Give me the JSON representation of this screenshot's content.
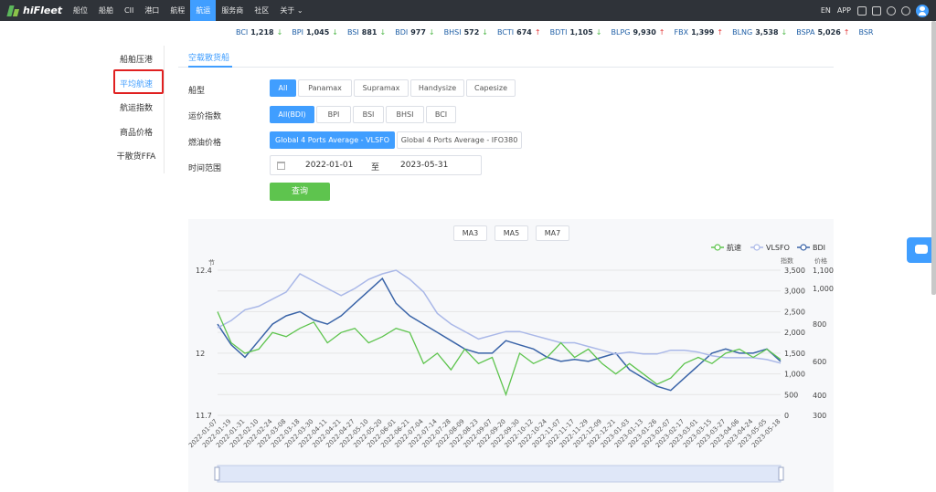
{
  "app": {
    "logo_text": "hiFleet",
    "accent": "#409eff"
  },
  "nav": {
    "items": [
      "船位",
      "船舶",
      "CII",
      "港口",
      "航程",
      "航运",
      "服务商",
      "社区",
      "关于"
    ],
    "active_index": 5
  },
  "top_right": {
    "lang": "EN",
    "app": "APP"
  },
  "ticker": [
    {
      "name": "BCI",
      "value": "1,218",
      "dir": "down"
    },
    {
      "name": "BPI",
      "value": "1,045",
      "dir": "down"
    },
    {
      "name": "BSI",
      "value": "881",
      "dir": "down"
    },
    {
      "name": "BDI",
      "value": "977",
      "dir": "down"
    },
    {
      "name": "BHSI",
      "value": "572",
      "dir": "down"
    },
    {
      "name": "BCTI",
      "value": "674",
      "dir": "up"
    },
    {
      "name": "BDTI",
      "value": "1,105",
      "dir": "down"
    },
    {
      "name": "BLPG",
      "value": "9,930",
      "dir": "up"
    },
    {
      "name": "FBX",
      "value": "1,399",
      "dir": "up"
    },
    {
      "name": "BLNG",
      "value": "3,538",
      "dir": "down"
    },
    {
      "name": "BSPA",
      "value": "5,026",
      "dir": "up"
    },
    {
      "name": "BSR",
      "value": "",
      "dir": ""
    }
  ],
  "sidebar": {
    "items": [
      "船舶压港",
      "平均航速",
      "航运指数",
      "商品价格",
      "干散货FFA"
    ],
    "active_index": 1
  },
  "tab": {
    "label": "空载散货船"
  },
  "filters": {
    "ship_type": {
      "label": "船型",
      "options": [
        "All",
        "Panamax",
        "Supramax",
        "Handysize",
        "Capesize"
      ],
      "selected": 0
    },
    "freight_index": {
      "label": "运价指数",
      "options": [
        "All(BDI)",
        "BPI",
        "BSI",
        "BHSI",
        "BCI"
      ],
      "selected": 0
    },
    "fuel_price": {
      "label": "燃油价格",
      "options": [
        "Global 4 Ports Average - VLSFO",
        "Global 4 Ports Average - IFO380"
      ],
      "selected": 0
    },
    "time_range": {
      "label": "时间范围",
      "start": "2022-01-01",
      "sep": "至",
      "end": "2023-05-31"
    },
    "query_label": "查询"
  },
  "chart_controls": {
    "ma": [
      "MA3",
      "MA5",
      "MA7"
    ]
  },
  "chart_data": {
    "type": "line",
    "legend": [
      {
        "name": "航速",
        "color": "#5ec44e"
      },
      {
        "name": "VLSFO",
        "color": "#aab8e8"
      },
      {
        "name": "BDI",
        "color": "#3a64a8"
      }
    ],
    "legend_position": "top-right",
    "left_axis": {
      "unit": "节",
      "ticks": [
        "12.4",
        "12",
        "11.7"
      ],
      "range": [
        11.7,
        12.4
      ]
    },
    "right_axis_bdi": {
      "unit": "指数",
      "ticks": [
        "3,500",
        "3,000",
        "2,500",
        "2,000",
        "1,500",
        "1,000",
        "500",
        "0"
      ],
      "range": [
        0,
        3500
      ]
    },
    "right_axis_price": {
      "unit": "价格",
      "ticks": [
        "1,100",
        "1,000",
        "800",
        "600",
        "400",
        "300"
      ]
    },
    "x_labels": [
      "2022-01-07",
      "2022-01-19",
      "2022-01-31",
      "2022-02-10",
      "2022-02-24",
      "2022-03-08",
      "2022-03-18",
      "2022-03-30",
      "2022-04-11",
      "2022-04-21",
      "2022-04-27",
      "2022-05-10",
      "2022-05-20",
      "2022-06-01",
      "2022-06-21",
      "2022-07-04",
      "2022-07-14",
      "2022-07-28",
      "2022-08-09",
      "2022-08-23",
      "2022-09-07",
      "2022-09-20",
      "2022-09-30",
      "2022-10-12",
      "2022-10-24",
      "2022-11-07",
      "2022-11-17",
      "2022-11-29",
      "2022-12-09",
      "2022-12-21",
      "2023-01-03",
      "2023-01-13",
      "2023-01-26",
      "2023-02-07",
      "2023-02-17",
      "2023-03-01",
      "2023-03-15",
      "2023-03-27",
      "2023-04-06",
      "2023-04-24",
      "2023-05-05",
      "2023-05-18"
    ],
    "series": [
      {
        "name": "BDI",
        "values": [
          2200,
          1700,
          1400,
          1800,
          2200,
          2400,
          2500,
          2300,
          2200,
          2400,
          2700,
          3000,
          3300,
          2700,
          2400,
          2200,
          2000,
          1800,
          1600,
          1500,
          1500,
          1800,
          1700,
          1600,
          1400,
          1300,
          1350,
          1300,
          1400,
          1500,
          1100,
          900,
          700,
          600,
          900,
          1200,
          1500,
          1600,
          1500,
          1500,
          1600,
          1300
        ]
      },
      {
        "name": "VLSFO",
        "values": [
          780,
          820,
          880,
          900,
          940,
          980,
          1080,
          1040,
          1000,
          960,
          1000,
          1050,
          1080,
          1120,
          1050,
          980,
          860,
          800,
          760,
          720,
          740,
          760,
          760,
          740,
          720,
          700,
          700,
          680,
          660,
          640,
          650,
          640,
          640,
          660,
          660,
          650,
          630,
          620,
          620,
          620,
          610,
          590
        ]
      },
      {
        "name": "航速",
        "values": [
          12.2,
          12.05,
          12.0,
          12.02,
          12.1,
          12.08,
          12.12,
          12.15,
          12.05,
          12.1,
          12.12,
          12.05,
          12.08,
          12.12,
          12.1,
          11.95,
          12.0,
          11.92,
          12.02,
          11.95,
          11.98,
          11.8,
          12.0,
          11.95,
          11.98,
          12.05,
          11.98,
          12.02,
          11.95,
          11.9,
          11.95,
          11.9,
          11.85,
          11.88,
          11.95,
          11.98,
          11.95,
          12.0,
          12.02,
          11.98,
          12.02,
          11.97
        ]
      }
    ]
  }
}
